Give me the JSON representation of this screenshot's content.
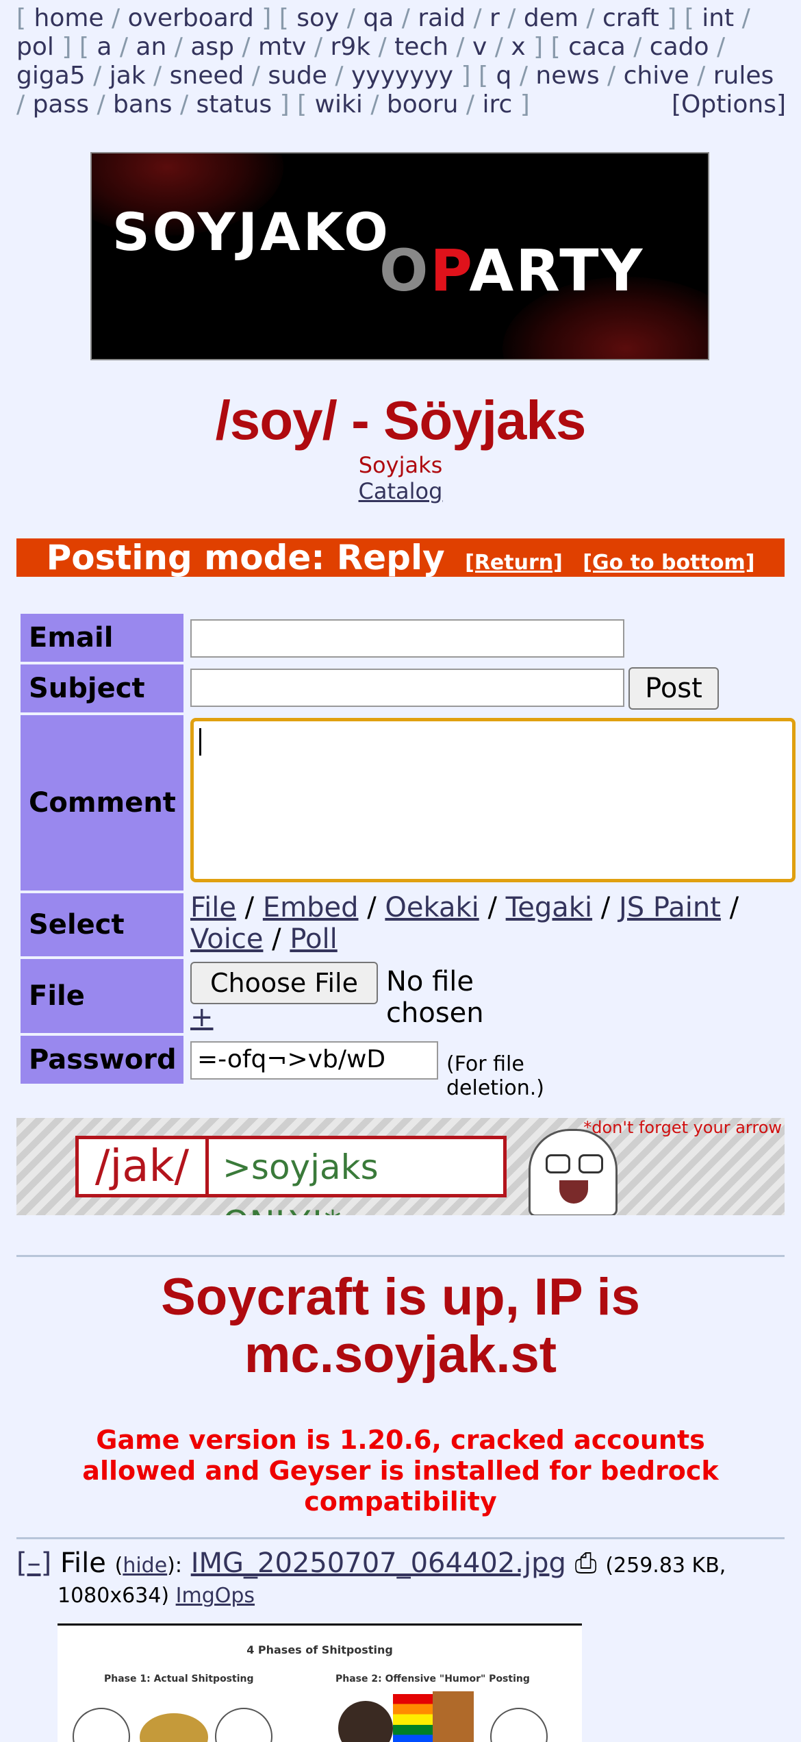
{
  "nav": {
    "groups": [
      [
        "home",
        "overboard"
      ],
      [
        "soy",
        "qa",
        "raid",
        "r",
        "dem",
        "craft"
      ],
      [
        "int",
        "pol"
      ],
      [
        "a",
        "an",
        "asp",
        "mtv",
        "r9k",
        "tech",
        "v",
        "x"
      ],
      [
        "caca",
        "cado",
        "giga5",
        "jak",
        "sneed",
        "sude",
        "yyyyyyy"
      ],
      [
        "q",
        "news",
        "chive",
        "rules",
        "pass",
        "bans",
        "status"
      ],
      [
        "wiki",
        "booru",
        "irc"
      ]
    ],
    "options": "[Options]"
  },
  "banner": {
    "word1": "SOYJAKO",
    "word2_o": "O",
    "word2_p": "P",
    "word2_rest": "ARTY"
  },
  "board": {
    "title": "/soy/ - Söyjaks",
    "subtitle": "Soyjaks",
    "catalog": "Catalog"
  },
  "postmode": {
    "text": "Posting mode: Reply",
    "return": "[Return]",
    "bottom": "[Go to bottom]"
  },
  "form": {
    "email_label": "Email",
    "subject_label": "Subject",
    "post_button": "Post",
    "comment_label": "Comment",
    "select_label": "Select",
    "select_options": [
      "File",
      "Embed",
      "Oekaki",
      "Tegaki",
      "JS Paint",
      "Voice",
      "Poll"
    ],
    "file_label": "File",
    "choose_file": "Choose File",
    "no_file": "No file chosen",
    "add_file": "+",
    "password_label": "Password",
    "password_value": "=-ofq¬>vb/wD",
    "password_note": "(For file deletion.)"
  },
  "ad": {
    "board": "/jak/",
    "slogan": ">soyjaks ONLY!*",
    "note": "*don't forget your arrow"
  },
  "announcement": {
    "headline": "Soycraft is up, IP is mc.soyjak.st",
    "details": "Game version is 1.20.6, cracked accounts allowed and Geyser is installed for bedrock compatibility"
  },
  "post": {
    "toggle": "[–]",
    "file_prefix": "File",
    "hide": "hide",
    "filename": "IMG_20250707_064402.jpg",
    "filesize": "(259.83 KB,",
    "dimensions": "1080x634)",
    "imgops": "ImgOps",
    "thumb_title": "4 Phases of Shitposting",
    "thumb_phase1": "Phase 1: Actual Shitposting",
    "thumb_phase2": "Phase 2: Offensive \"Humor\" Posting"
  }
}
